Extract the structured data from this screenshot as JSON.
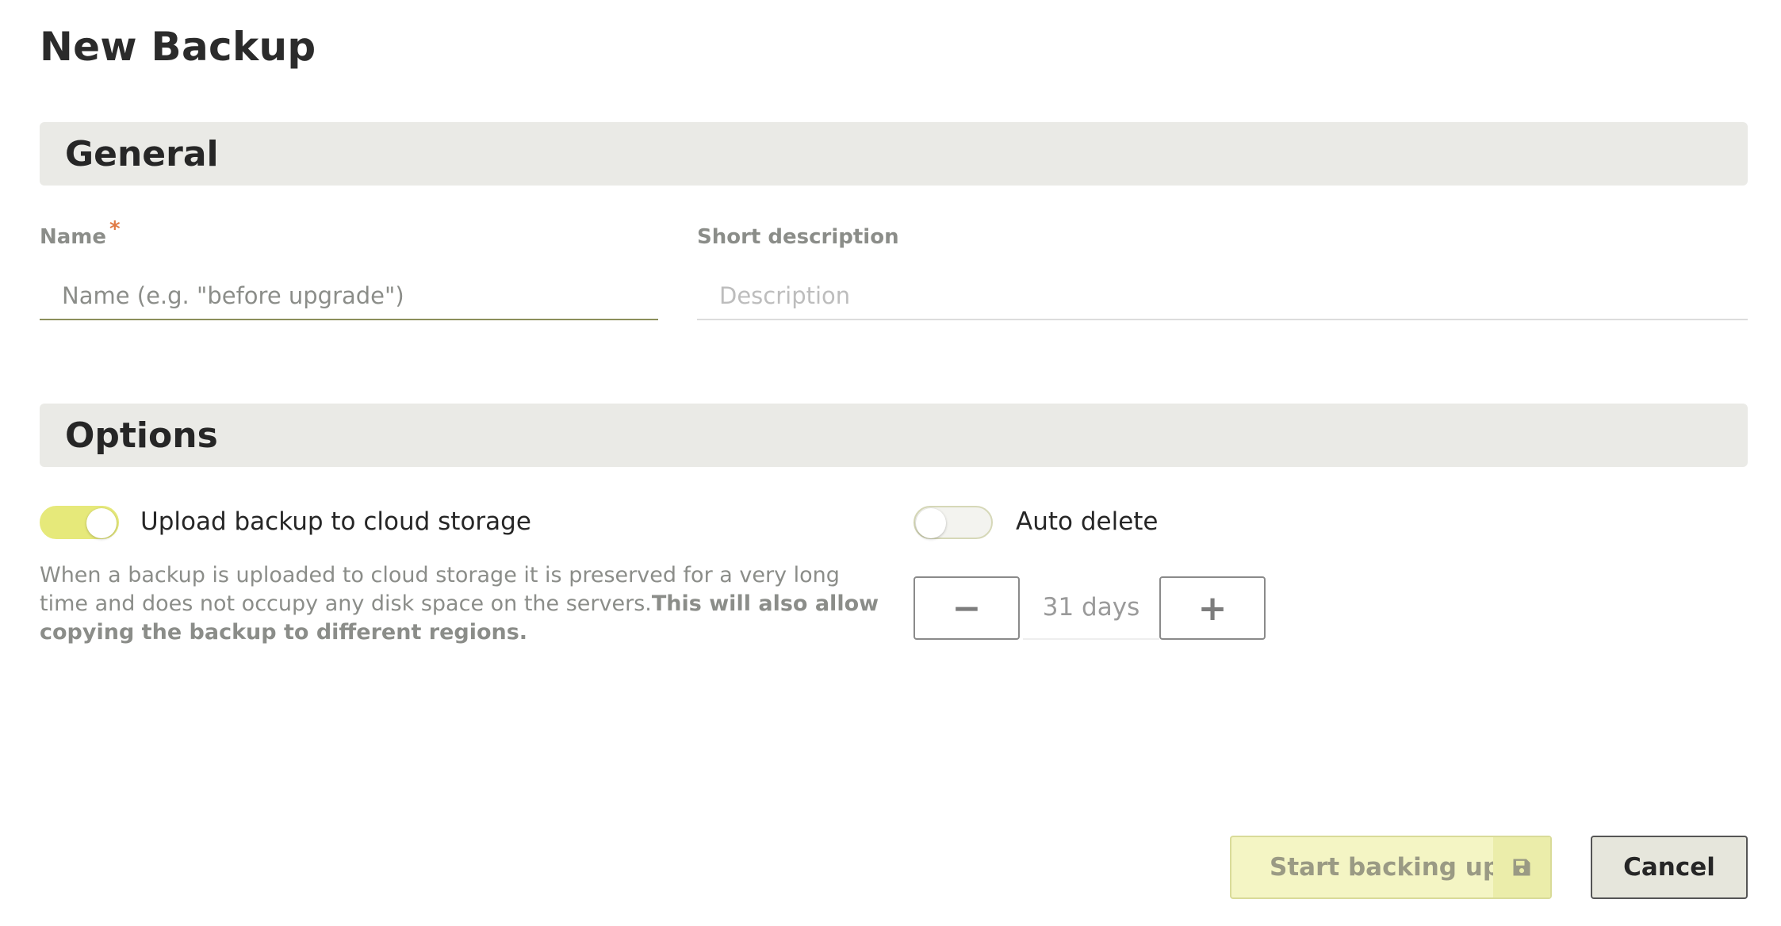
{
  "page": {
    "title": "New Backup"
  },
  "sections": {
    "general": {
      "title": "General"
    },
    "options": {
      "title": "Options"
    }
  },
  "general": {
    "name_field": {
      "label": "Name",
      "required_mark": "*",
      "placeholder": "Name (e.g. \"before upgrade\")",
      "value": ""
    },
    "description_field": {
      "label": "Short description",
      "placeholder": "Description",
      "value": ""
    }
  },
  "options": {
    "cloud_upload": {
      "label": "Upload backup to cloud storage",
      "enabled": true,
      "help_text": "When a backup is uploaded to cloud storage it is preserved for a very long time and does not occupy any disk space on the servers.",
      "help_text_bold": "This will also allow copying the backup to different regions."
    },
    "auto_delete": {
      "label": "Auto delete",
      "enabled": false,
      "decrement_label": "−",
      "increment_label": "+",
      "value_text": "31 days"
    }
  },
  "actions": {
    "start_label": "Start backing up",
    "start_icon": "save-icon",
    "cancel_label": "Cancel"
  },
  "colors": {
    "accent": "#e6e97a",
    "section_bg": "#eaeae6",
    "required": "#e07a45",
    "primary_button_bg": "#f4f5c4",
    "cancel_button_bg": "#e6e6dc"
  }
}
